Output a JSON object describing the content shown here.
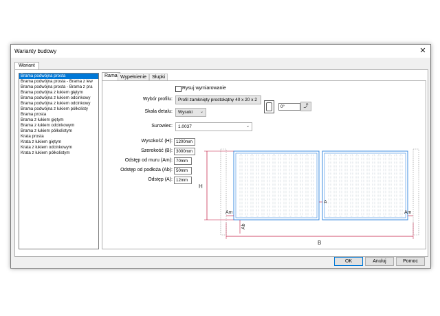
{
  "window": {
    "title": "Warianty budowy"
  },
  "outer_tab": "Wariant",
  "variants": [
    "Brama podwójna prosta",
    "Brama podwójna prosta - Brama z lew",
    "Brama podwójna prosta - Brama z pra",
    "Brama podwójna z łukiem giętym",
    "Brama podwójna z łukiem odcinkowy",
    "Brama podwójna z łukiem odcinkowy",
    "Brama podwójna z łukiem półkolisty",
    "Brama prosta",
    "Brama z łukiem giętym",
    "Brama z łukiem odcinkowym",
    "Brama z łukiem półkolistym",
    "Krata prosta",
    "Krata z łukiem giętym",
    "Krata z łukiem odcinkowym",
    "Krata z łukiem półkolistym"
  ],
  "selected_index": 0,
  "tabs": [
    "Rama",
    "Wypełnienie",
    "Słupki"
  ],
  "form": {
    "draw_dimensions_label": "Rysuj wymiarowanie",
    "profile_label": "Wybór profilu:",
    "profile_value": "Profil zamknięty prostokątny  40 x 20 x 2",
    "angle_value": "0°",
    "detail_label": "Skala detalu:",
    "detail_value": "Wysoki",
    "material_label": "Surowiec:",
    "material_value": "1.0037",
    "height_label": "Wysokość (H):",
    "height_value": "1200mm",
    "width_label": "Szerokość (B):",
    "width_value": "3000mm",
    "wall_gap_label": "Odstęp od muru (Am):",
    "wall_gap_value": "70mm",
    "floor_gap_label": "Odstęp od podłoża (Ab):",
    "floor_gap_value": "50mm",
    "gap_label": "Odstęp (A):",
    "gap_value": "12mm"
  },
  "drawing_labels": {
    "H": "H",
    "B": "B",
    "A": "A",
    "Am_left": "Am",
    "Am_right": "Am",
    "Ab": "Ab"
  },
  "buttons": {
    "ok": "OK",
    "cancel": "Anuluj",
    "help": "Pomoc"
  },
  "colors": {
    "selection": "#0078d7",
    "gate_outline": "#3c8ce0",
    "dimension": "#c0143c"
  }
}
